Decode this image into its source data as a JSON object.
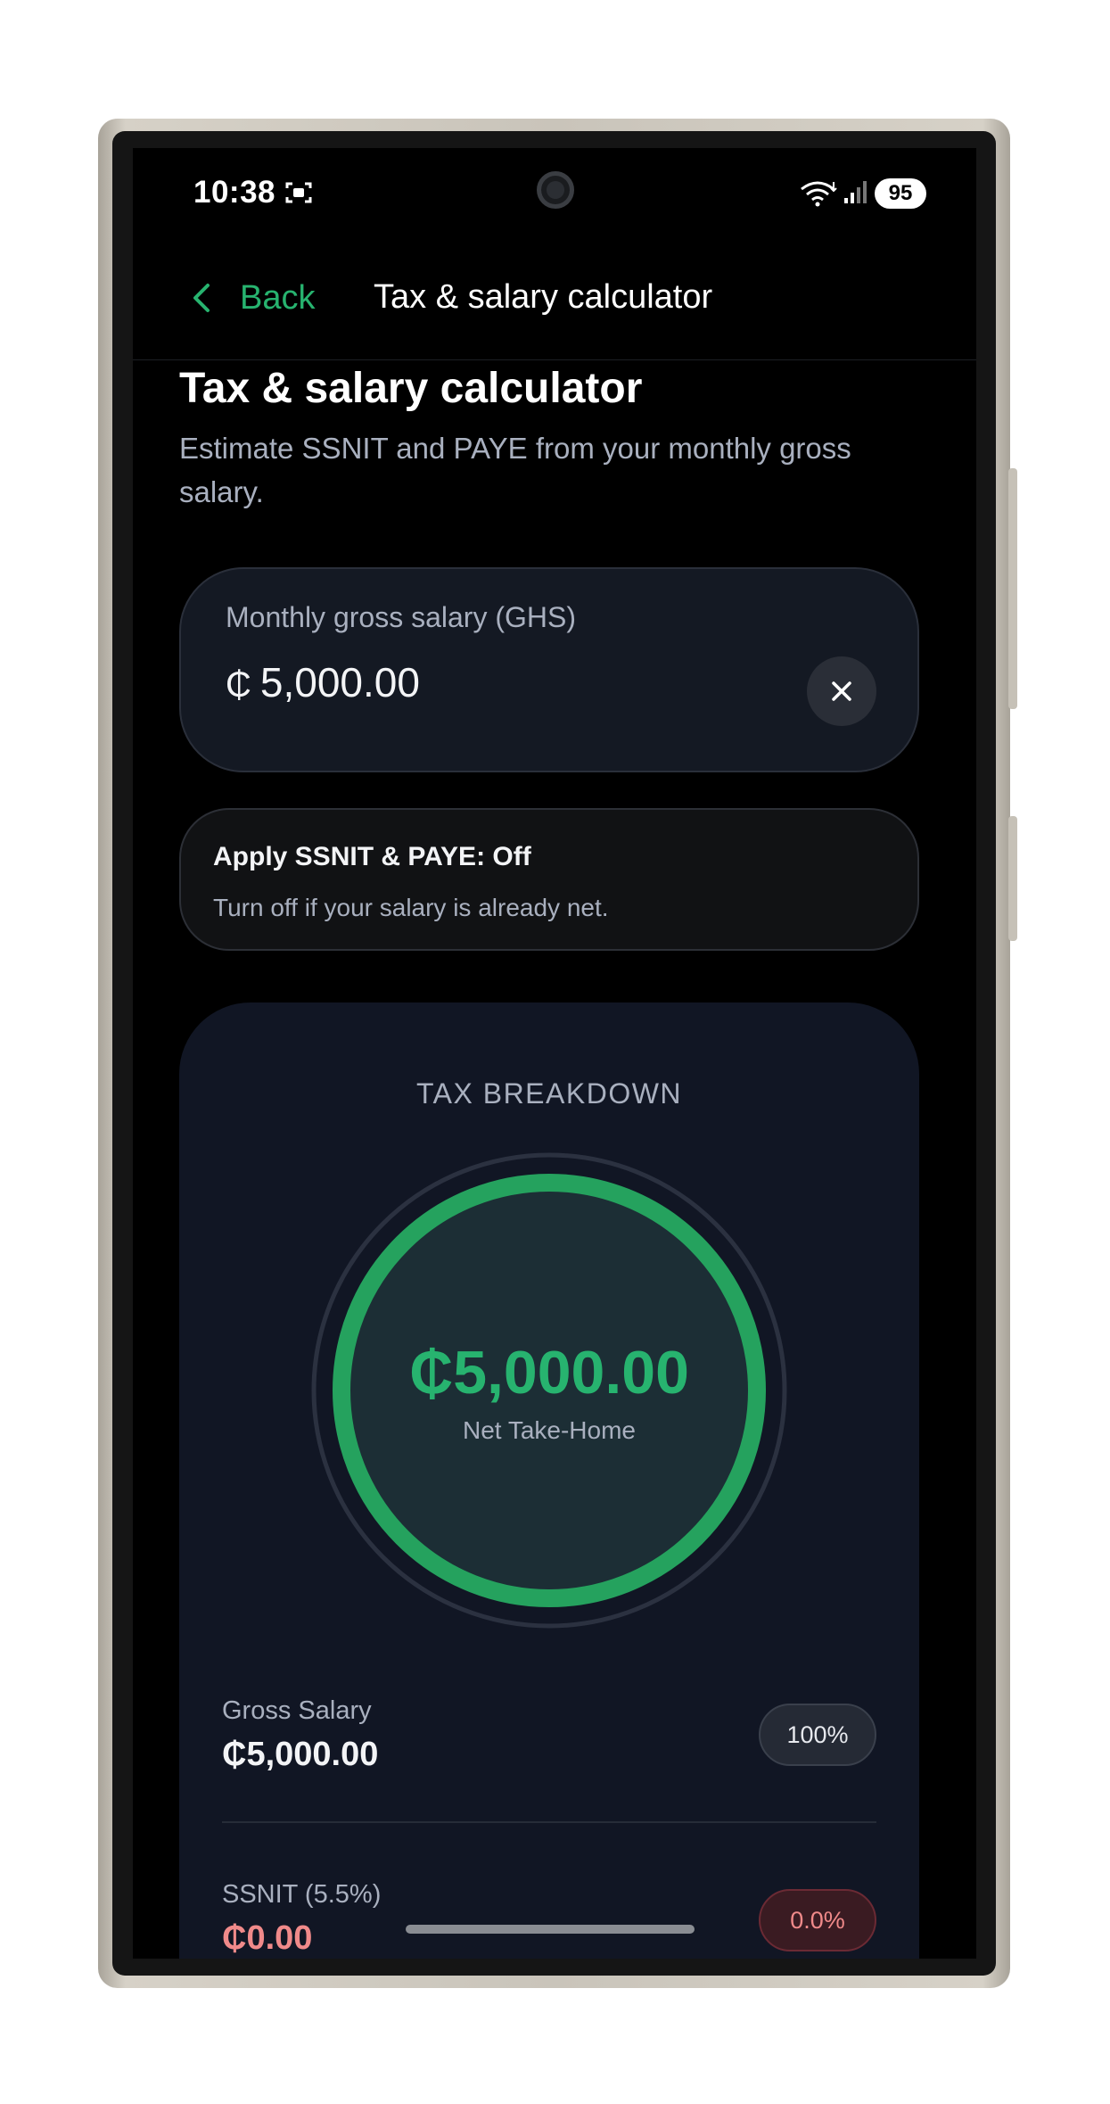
{
  "status_bar": {
    "time": "10:38",
    "battery": "95"
  },
  "nav": {
    "back_label": "Back",
    "title": "Tax & salary calculator"
  },
  "page": {
    "heading": "Tax & salary calculator",
    "subtitle": "Estimate SSNIT and PAYE from your monthly gross salary."
  },
  "salary_input": {
    "label": "Monthly gross salary (GHS)",
    "currency_symbol": "₵",
    "value": "5,000.00"
  },
  "toggle": {
    "title": "Apply SSNIT & PAYE: Off",
    "description": "Turn off if your salary is already net.",
    "state": "off"
  },
  "breakdown": {
    "title": "TAX BREAKDOWN",
    "net_value": "₵5,000.00",
    "net_label": "Net Take-Home",
    "net_fraction": 1.0,
    "rows": [
      {
        "label": "Gross Salary",
        "value": "₵5,000.00",
        "pill": "100%"
      },
      {
        "label": "SSNIT (5.5%)",
        "value": "₵0.00",
        "pill": "0.0%"
      }
    ]
  },
  "colors": {
    "accent": "#27b36f",
    "background": "#000000",
    "card": "#111624",
    "muted_text": "#a9b0bf",
    "negative": "#f08a8a"
  }
}
